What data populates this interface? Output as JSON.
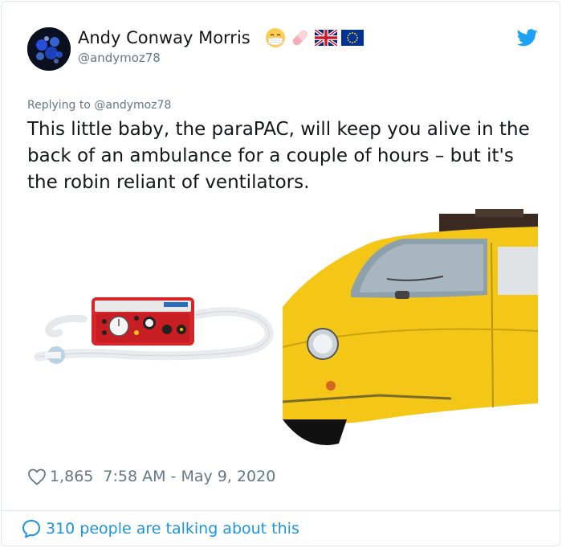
{
  "tweet": {
    "author_name": "Andy Conway Morris",
    "author_handle": "@andymoz78",
    "emojis": [
      "face-with-mask-emoji",
      "pill-emoji",
      "uk-flag-emoji",
      "eu-flag-emoji"
    ],
    "replying_to": "Replying to @andymoz78",
    "text": "This little baby, the paraPAC, will keep you alive in the back of an ambulance for a couple of hours – but it's the robin reliant of ventilators.",
    "likes": "1,865",
    "timestamp": "7:58 AM - May 9, 2020",
    "conversation": "310 people are talking about this"
  },
  "colors": {
    "twitter_blue": "#1da1f2",
    "link_blue": "#1b95e0",
    "muted": "#657786",
    "text": "#14171a",
    "border": "#e1e8ed"
  },
  "icons": {
    "brand": "twitter-bird-icon",
    "like": "heart-icon",
    "talk": "speech-bubble-icon"
  }
}
